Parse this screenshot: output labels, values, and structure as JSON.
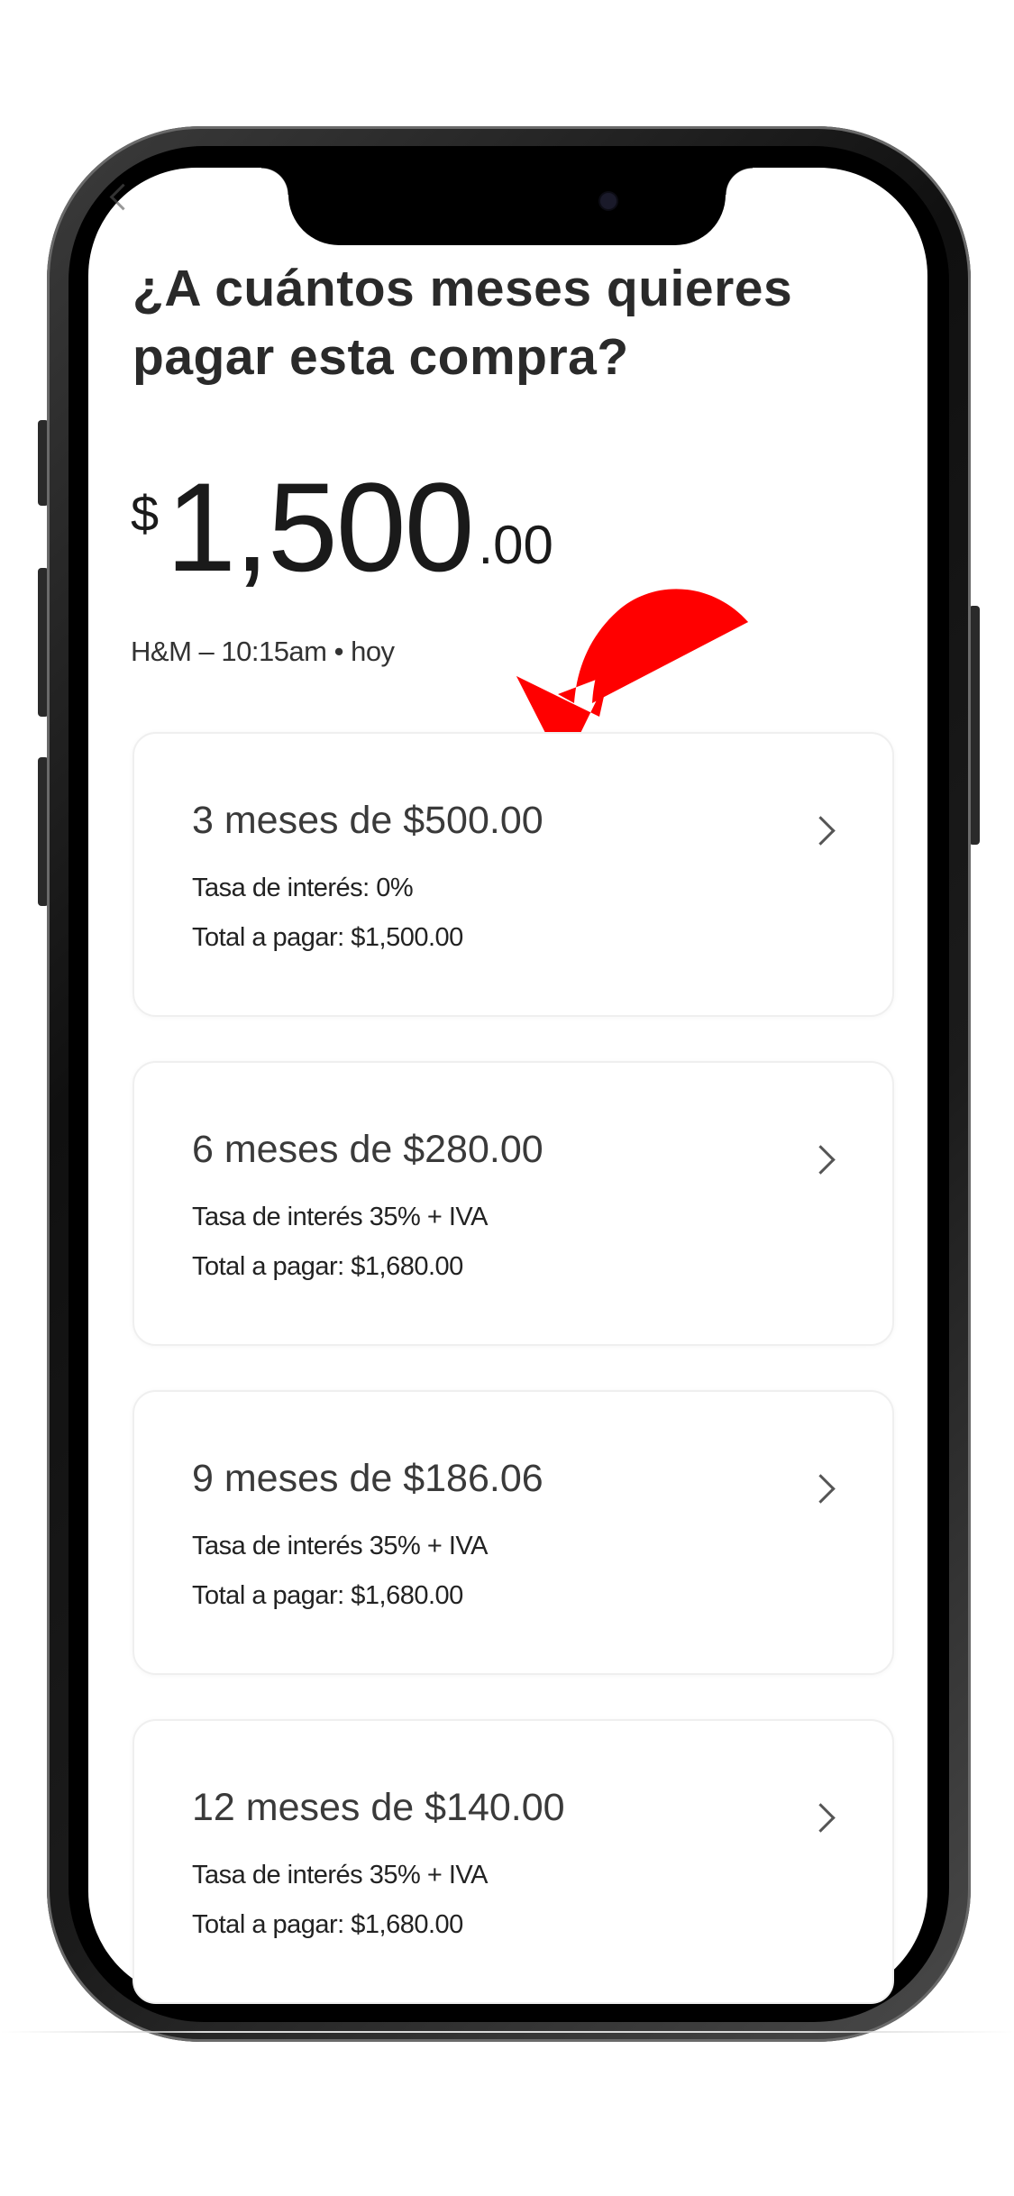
{
  "header": {
    "title": "¿A cuántos meses quieres pagar esta compra?"
  },
  "purchase": {
    "currency_symbol": "$",
    "amount_main": "1,500",
    "amount_cents": ".00",
    "details": "H&M – 10:15am • hoy"
  },
  "plans": [
    {
      "title": "3 meses de $500.00",
      "rate": "Tasa de interés: 0%",
      "total": "Total a pagar: $1,500.00"
    },
    {
      "title": "6 meses de $280.00",
      "rate": "Tasa de interés 35% + IVA",
      "total": "Total a pagar: $1,680.00"
    },
    {
      "title": "9 meses de $186.06",
      "rate": "Tasa de interés 35% + IVA",
      "total": "Total a pagar: $1,680.00"
    },
    {
      "title": "12 meses de $140.00",
      "rate": "Tasa de interés 35% + IVA",
      "total": "Total a pagar: $1,680.00"
    }
  ],
  "icons": {
    "back": "back-chevron-icon",
    "plan_chevron": "chevron-right-icon",
    "annotation": "red-curved-arrow-icon"
  },
  "colors": {
    "annotation_arrow": "#ff0000",
    "text_primary": "#2a2a2a",
    "card_border": "#efefef"
  }
}
